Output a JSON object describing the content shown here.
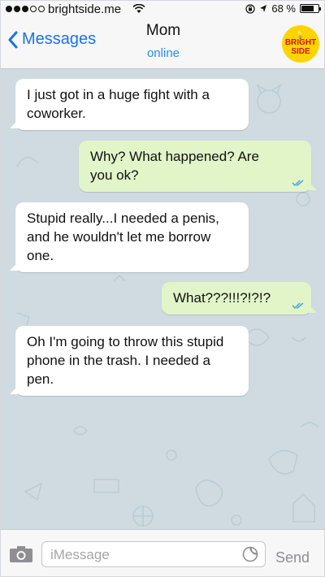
{
  "status_bar": {
    "carrier": "brightside.me",
    "battery": "68 %",
    "signal_dots_filled": 3,
    "signal_dots_total": 5
  },
  "header": {
    "back_label": "Messages",
    "contact_name": "Mom",
    "contact_status": "online",
    "logo_line1": "BRIGHT",
    "logo_line2": "SIDE"
  },
  "messages": [
    {
      "direction": "incoming",
      "text": "I just got in a huge fight with a coworker."
    },
    {
      "direction": "outgoing",
      "text": "Why? What happened? Are you ok?",
      "status": "read"
    },
    {
      "direction": "incoming",
      "text": "Stupid really...I needed a penis, and he wouldn't let me borrow one."
    },
    {
      "direction": "outgoing",
      "text": "What???!!!?!?!?",
      "status": "read"
    },
    {
      "direction": "incoming",
      "text": "Oh I'm going to throw this stupid phone in the trash. I needed a pen."
    }
  ],
  "input": {
    "placeholder": "iMessage",
    "send_label": "Send"
  },
  "colors": {
    "accent": "#1a73e8",
    "incoming_bubble": "#ffffff",
    "outgoing_bubble": "#e1f5c9",
    "chat_background": "#cfdbe1",
    "logo_yellow": "#ffd400",
    "logo_red": "#d3131b"
  }
}
